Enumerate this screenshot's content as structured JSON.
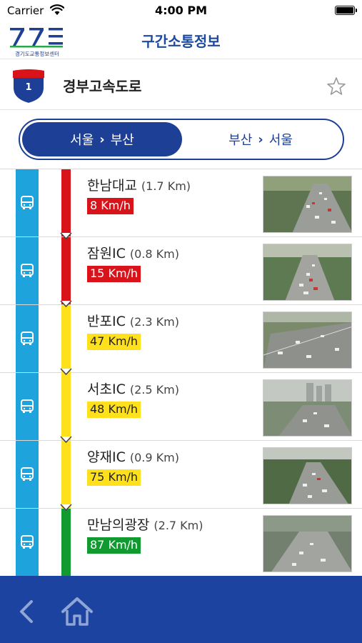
{
  "status": {
    "carrier": "Carrier",
    "time": "4:00 PM"
  },
  "header": {
    "logo_caption": "경기도교통정보센터",
    "title": "구간소통정보"
  },
  "route": {
    "number": "1",
    "name": "경부고속도로"
  },
  "direction": {
    "active": {
      "from": "서울",
      "to": "부산"
    },
    "inactive": {
      "from": "부산",
      "to": "서울"
    }
  },
  "colors": {
    "brand": "#1d3f95",
    "red": "#d8131a",
    "yellow": "#ffe01c",
    "green": "#119a30",
    "bus_lane": "#1ea3dd"
  },
  "sections": [
    {
      "name": "한남대교",
      "distance": "(1.7 Km)",
      "speed": "8 Km/h",
      "level": "red"
    },
    {
      "name": "잠원IC",
      "distance": "(0.8 Km)",
      "speed": "15 Km/h",
      "level": "red"
    },
    {
      "name": "반포IC",
      "distance": "(2.3 Km)",
      "speed": "47 Km/h",
      "level": "yellow"
    },
    {
      "name": "서초IC",
      "distance": "(2.5 Km)",
      "speed": "48 Km/h",
      "level": "yellow"
    },
    {
      "name": "양재IC",
      "distance": "(0.9 Km)",
      "speed": "75 Km/h",
      "level": "yellow"
    },
    {
      "name": "만남의광장",
      "distance": "(2.7 Km)",
      "speed": "87 Km/h",
      "level": "green"
    }
  ],
  "icons": {
    "back": "chevron-left-icon",
    "home": "home-icon",
    "favorite": "star-outline-icon",
    "bus": "bus-icon"
  }
}
